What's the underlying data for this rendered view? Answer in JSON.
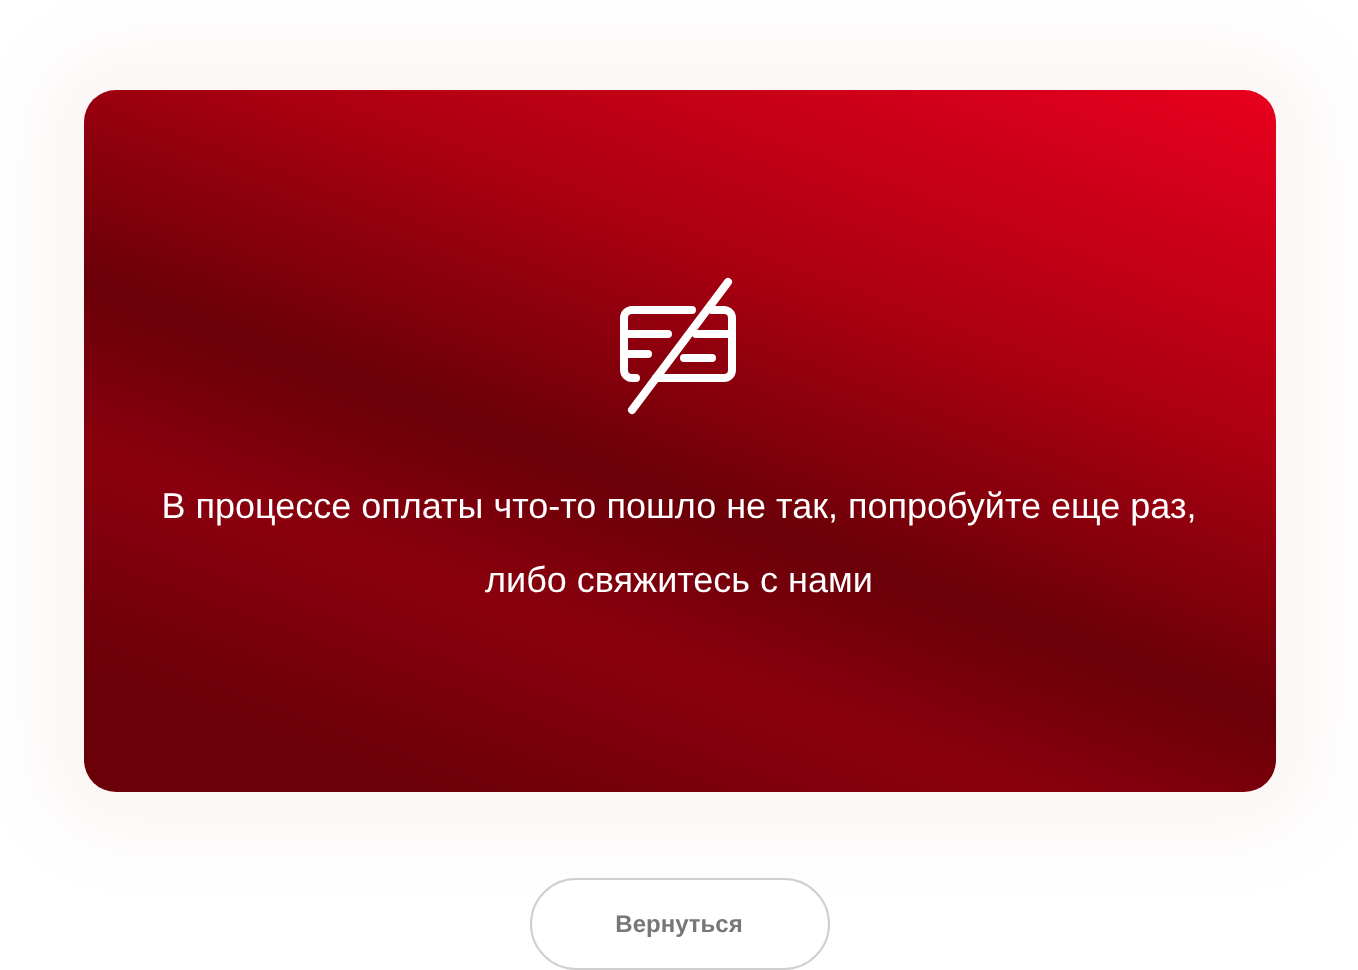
{
  "error_card": {
    "message": "В процессе оплаты что-то пошло не так, попробуйте еще раз, либо свяжитесь с нами"
  },
  "back_button": {
    "label": "Вернуться"
  }
}
